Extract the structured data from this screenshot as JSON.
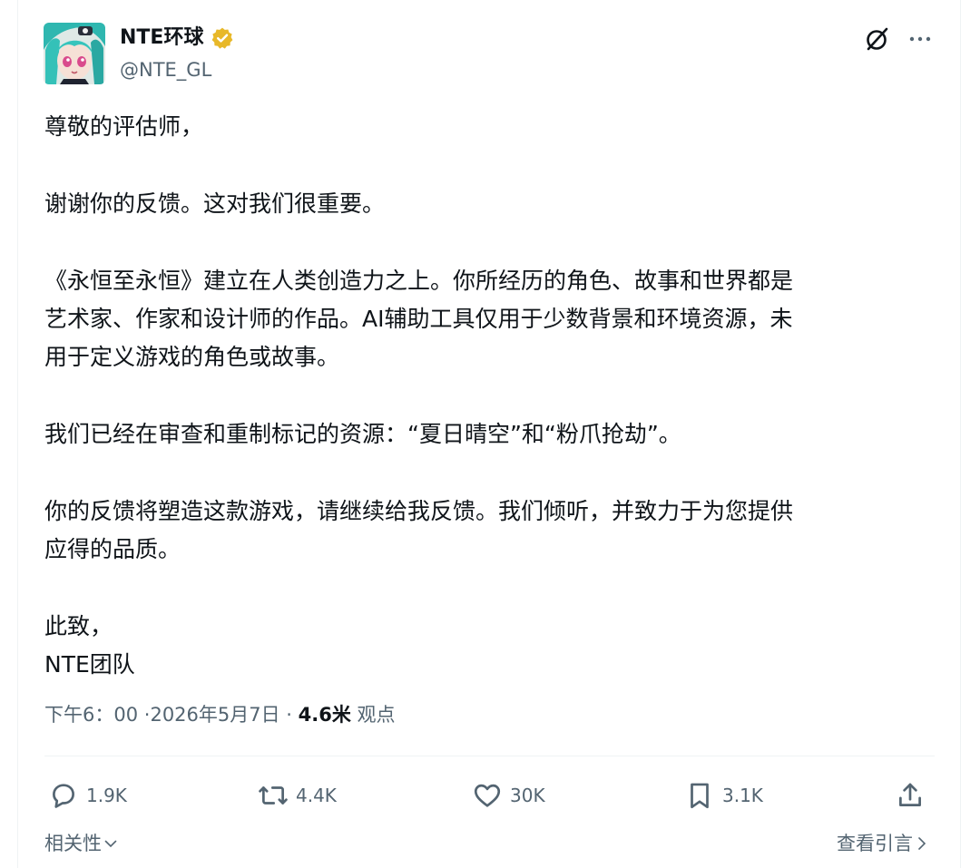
{
  "author": {
    "display_name": "NTE环球",
    "handle": "@NTE_GL",
    "verified_color": "#e8b829"
  },
  "header_icons": {
    "grok": "grok-icon",
    "more": "more-icon"
  },
  "post": {
    "paragraphs": [
      [
        "尊敬的评估师，"
      ],
      [
        "谢谢你的反馈。这对我们很重要。"
      ],
      [
        "《永恒至永恒》建立在人类创造力之上。你所经历的角色、故事和世界都是",
        "艺术家、作家和设计师的作品。AI辅助工具仅用于少数背景和环境资源，未",
        "用于定义游戏的角色或故事。"
      ],
      [
        "我们已经在审查和重制标记的资源：“夏日晴空”和“粉爪抢劫”。"
      ],
      [
        "你的反馈将塑造这款游戏，请继续给我反馈。我们倾听，并致力于为您提供",
        "应得的品质。"
      ],
      [
        "此致，",
        "NTE团队"
      ]
    ]
  },
  "meta": {
    "time": "下午6：00",
    "separator1": " ·",
    "date": "2026年5月7日",
    "separator2": " · ",
    "views_count": "4.6米",
    "views_label": " 观点"
  },
  "actions": {
    "replies": "1.9K",
    "retweets": "4.4K",
    "likes": "30K",
    "bookmarks": "3.1K"
  },
  "footer": {
    "sort_label": "相关性",
    "quotes_label": "查看引言"
  },
  "colors": {
    "text_primary": "#0f1419",
    "text_secondary": "#536471",
    "divider": "#eff3f4"
  }
}
